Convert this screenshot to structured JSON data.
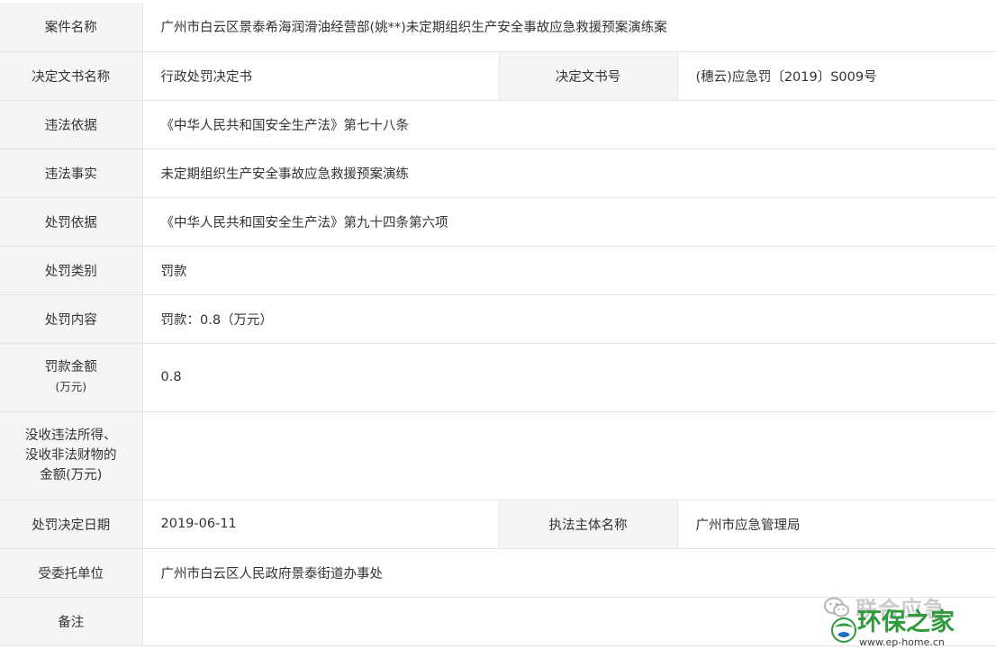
{
  "rows": [
    {
      "label": "案件名称",
      "value": "广州市白云区景泰希海润滑油经营部(姚**)未定期组织生产安全事故应急救援预案演练案"
    },
    {
      "label": "决定文书名称",
      "value": "行政处罚决定书",
      "label2": "决定文书号",
      "value2": "(穗云)应急罚〔2019〕S009号"
    },
    {
      "label": "违法依据",
      "value": "《中华人民共和国安全生产法》第七十八条"
    },
    {
      "label": "违法事实",
      "value": "未定期组织生产安全事故应急救援预案演练"
    },
    {
      "label": "处罚依据",
      "value": "《中华人民共和国安全生产法》第九十四条第六项"
    },
    {
      "label": "处罚类别",
      "value": "罚款"
    },
    {
      "label": "处罚内容",
      "value": "罚款：0.8（万元）"
    },
    {
      "label_lines": [
        "罚款金额",
        "(万元)"
      ],
      "value": "0.8"
    },
    {
      "label_lines": [
        "没收违法所得、",
        "没收非法财物的",
        "金额(万元)"
      ],
      "value": ""
    },
    {
      "label": "处罚决定日期",
      "value": "2019-06-11",
      "label2": "执法主体名称",
      "value2": "广州市应急管理局"
    },
    {
      "label": "受委托单位",
      "value": "广州市白云区人民政府景泰街道办事处"
    },
    {
      "label": "备注",
      "value": ""
    }
  ],
  "watermark": {
    "account": "联合应急",
    "site": "环保之家",
    "url": "www.ep-home.cn",
    "icons": [
      "wechat-icon",
      "globe-icon"
    ],
    "colors": {
      "site": "#2e9a3b",
      "account": "#a0a0a0"
    }
  }
}
